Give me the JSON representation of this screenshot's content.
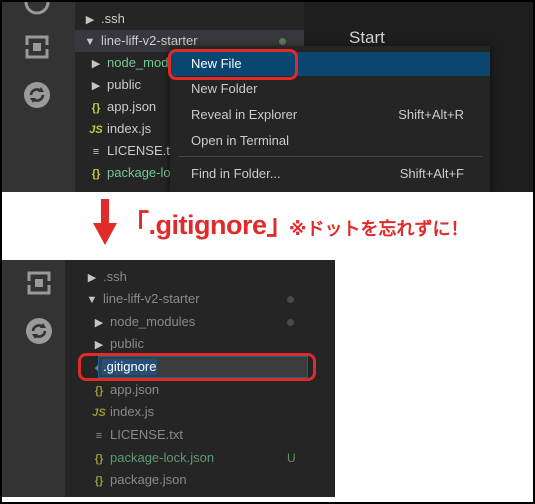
{
  "top": {
    "editor": {
      "start_label": "Start"
    },
    "explorer": {
      "items": [
        {
          "label": ".ssh",
          "icon": "chevron-right-icon"
        },
        {
          "label": "line-liff-v2-starter",
          "icon": "chevron-down-icon"
        },
        {
          "label": "node_modules",
          "icon": "chevron-right-icon"
        },
        {
          "label": "public",
          "icon": "chevron-right-icon"
        },
        {
          "label": "app.json",
          "icon": "json-icon",
          "glyph": "{}"
        },
        {
          "label": "index.js",
          "icon": "js-icon",
          "glyph": "JS"
        },
        {
          "label": "LICENSE.txt",
          "icon": "license-icon",
          "glyph": "≡"
        },
        {
          "label": "package-lock.json",
          "icon": "json-icon",
          "glyph": "{}"
        }
      ]
    },
    "context_menu": {
      "items": [
        {
          "label": "New File",
          "shortcut": ""
        },
        {
          "label": "New Folder",
          "shortcut": ""
        },
        {
          "label": "Reveal in Explorer",
          "shortcut": "Shift+Alt+R"
        },
        {
          "label": "Open in Terminal",
          "shortcut": ""
        },
        {
          "label": "Find in Folder...",
          "shortcut": "Shift+Alt+F"
        }
      ]
    }
  },
  "caption": {
    "main": "「.gitignore」",
    "note": "※ドットを忘れずに！"
  },
  "bottom": {
    "explorer": {
      "items": [
        {
          "label": ".ssh",
          "icon": "chevron-right-icon"
        },
        {
          "label": "line-liff-v2-starter",
          "icon": "chevron-down-icon"
        },
        {
          "label": "node_modules",
          "icon": "chevron-right-icon"
        },
        {
          "label": "public",
          "icon": "chevron-right-icon"
        },
        {
          "label": "app.json",
          "icon": "json-icon",
          "glyph": "{}"
        },
        {
          "label": "index.js",
          "icon": "js-icon",
          "glyph": "JS"
        },
        {
          "label": "LICENSE.txt",
          "icon": "license-icon",
          "glyph": "≡"
        },
        {
          "label": "package-lock.json",
          "icon": "json-icon",
          "glyph": "{}",
          "badge": "U"
        },
        {
          "label": "package.json",
          "icon": "json-icon",
          "glyph": "{}"
        }
      ],
      "rename_input_value": ".gitignore"
    }
  },
  "colors": {
    "accent_red": "#e02b2b",
    "menu_highlight": "#094771",
    "untracked_green": "#73c991"
  }
}
